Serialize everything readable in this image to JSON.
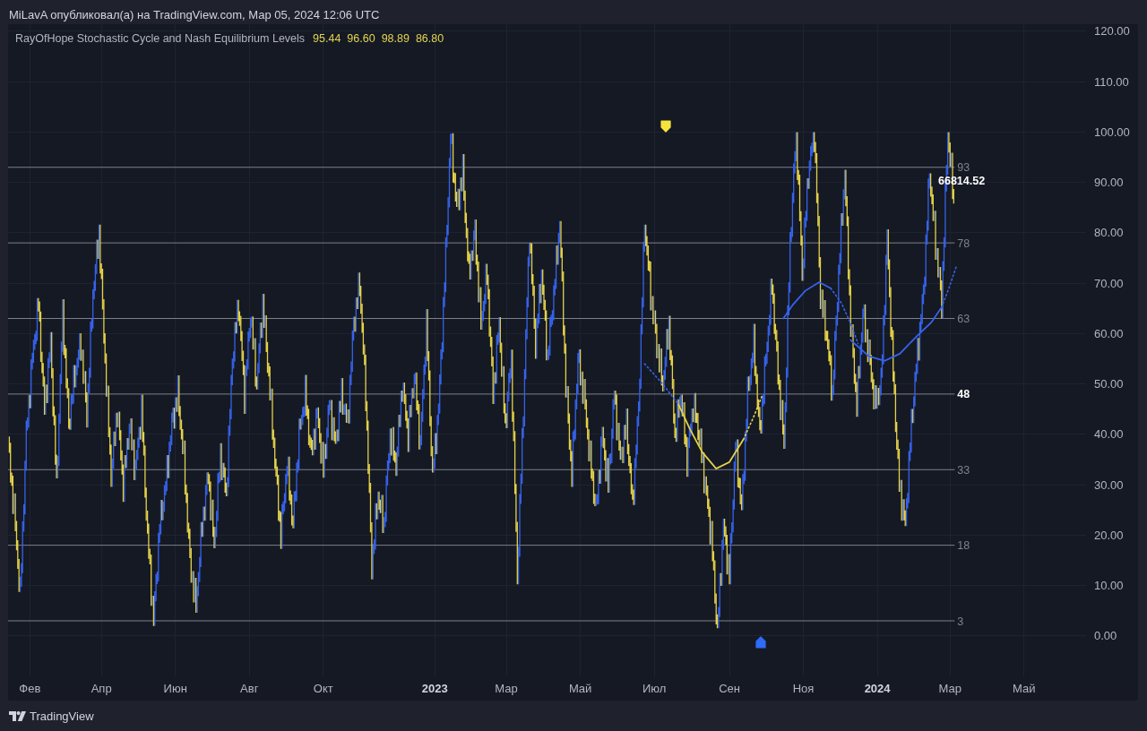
{
  "header": {
    "caption": "MiLavA опубликовал(а) на TradingView.com, Мар 05, 2024 12:06 UTC"
  },
  "legend": {
    "title": "RayOfHope Stochastic Cycle and Nash Equilibrium Levels",
    "values": [
      "95.44",
      "96.60",
      "98.89",
      "86.80"
    ]
  },
  "levels": [
    {
      "label": "93",
      "highlighted": false
    },
    {
      "label": "78",
      "highlighted": false
    },
    {
      "label": "63",
      "highlighted": false
    },
    {
      "label": "48",
      "highlighted": true
    },
    {
      "label": "33",
      "highlighted": false
    },
    {
      "label": "18",
      "highlighted": false
    },
    {
      "label": "3",
      "highlighted": false
    }
  ],
  "price_label": "66814.52",
  "price_axis": {
    "labels": [
      "120.00",
      "110.00",
      "100.00",
      "90.00",
      "80.00",
      "70.00",
      "60.00",
      "50.00",
      "40.00",
      "30.00",
      "20.00",
      "10.00",
      "0.00"
    ]
  },
  "time_axis": {
    "labels": [
      {
        "text": "Фев",
        "kind": "month"
      },
      {
        "text": "Апр",
        "kind": "month"
      },
      {
        "text": "Июн",
        "kind": "month"
      },
      {
        "text": "Авг",
        "kind": "month"
      },
      {
        "text": "Окт",
        "kind": "month"
      },
      {
        "text": "2023",
        "kind": "year"
      },
      {
        "text": "Мар",
        "kind": "month"
      },
      {
        "text": "Май",
        "kind": "month"
      },
      {
        "text": "Июл",
        "kind": "month"
      },
      {
        "text": "Сен",
        "kind": "month"
      },
      {
        "text": "Ноя",
        "kind": "month"
      },
      {
        "text": "2024",
        "kind": "year"
      },
      {
        "text": "Мар",
        "kind": "month"
      },
      {
        "text": "Май",
        "kind": "month"
      }
    ]
  },
  "footer": {
    "brand": "TradingView"
  }
}
